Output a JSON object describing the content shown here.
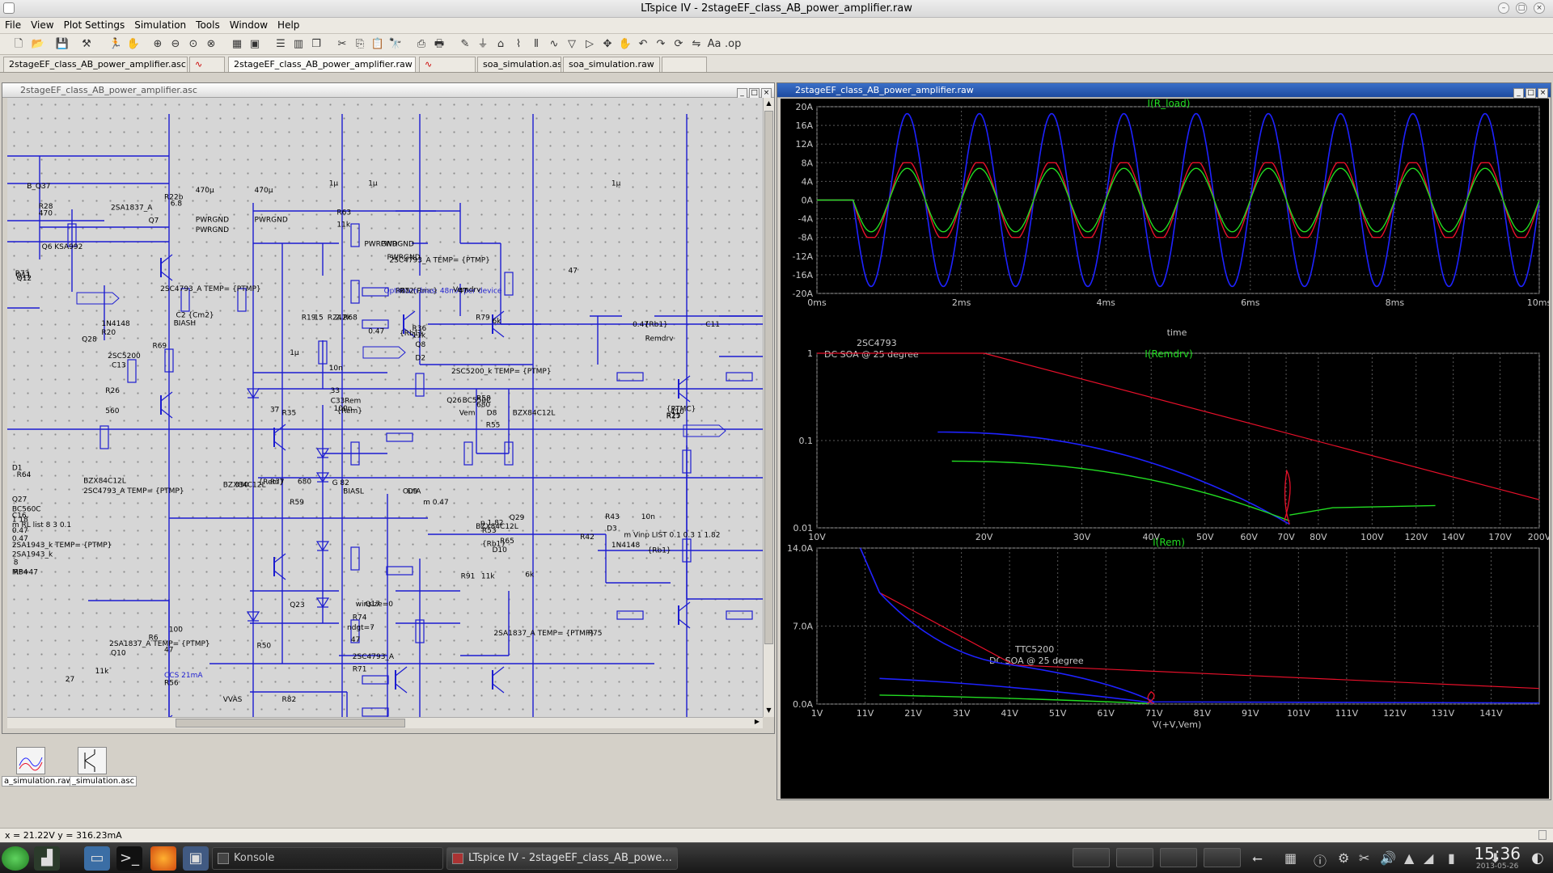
{
  "window": {
    "title": "LTspice IV - 2stageEF_class_AB_power_amplifier.raw"
  },
  "menu": [
    "File",
    "View",
    "Plot Settings",
    "Simulation",
    "Tools",
    "Window",
    "Help"
  ],
  "tabs": [
    {
      "label": "2stageEF_class_AB_power_amplifier.asc",
      "active": false
    },
    {
      "label": "",
      "active": false
    },
    {
      "label": "2stageEF_class_AB_power_amplifier.raw",
      "active": true
    },
    {
      "label": "",
      "active": false
    },
    {
      "label": "soa_simulation.asc",
      "active": false
    },
    {
      "label": "soa_simulation.raw",
      "active": false
    },
    {
      "label": "",
      "active": false
    }
  ],
  "schematic": {
    "title": "2stageEF_class_AB_power_amplifier.asc",
    "labels": [
      {
        "t": "B_Q37"
      },
      {
        "t": "R28"
      },
      {
        "t": "470"
      },
      {
        "t": "2SA1837_A"
      },
      {
        "t": "R22b"
      },
      {
        "t": "6.8"
      },
      {
        "t": "Q7"
      },
      {
        "t": "470µ"
      },
      {
        "t": "470µ"
      },
      {
        "t": "1µ"
      },
      {
        "t": "R63"
      },
      {
        "t": "11k"
      },
      {
        "t": "1µ"
      },
      {
        "t": "1µ"
      },
      {
        "t": "Q6"
      },
      {
        "t": "KSA992"
      },
      {
        "t": "PWRGND"
      },
      {
        "t": "PWRGND"
      },
      {
        "t": "PWRGND"
      },
      {
        "t": "PWRGND"
      },
      {
        "t": "PWRGND"
      },
      {
        "t": "PWRGND"
      },
      {
        "t": "2SC4793_A TEMP= {PTMP}"
      },
      {
        "t": "R73"
      },
      {
        "t": "47"
      },
      {
        "t": "R85 {Rmc}"
      },
      {
        "t": "Optimum bias: 48mA per device"
      },
      {
        "t": "R72"
      },
      {
        "t": "47"
      },
      {
        "t": "Q11"
      },
      {
        "t": "Q12"
      },
      {
        "t": "2SC4793_A TEMP= {PTMP}"
      },
      {
        "t": "C2 {Cm2}"
      },
      {
        "t": "BIASH"
      },
      {
        "t": "R19"
      },
      {
        "t": "15"
      },
      {
        "t": "R24"
      },
      {
        "t": "2.2k"
      },
      {
        "t": "R79"
      },
      {
        "t": "6k"
      },
      {
        "t": "R36"
      },
      {
        "t": "11k"
      },
      {
        "t": "Vemdrv"
      },
      {
        "t": "1N4148"
      },
      {
        "t": "R20"
      },
      {
        "t": "0.47"
      },
      {
        "t": "R68"
      },
      {
        "t": "{Rb1}"
      },
      {
        "t": "Q28"
      },
      {
        "t": "R69"
      },
      {
        "t": "{Rb1}"
      },
      {
        "t": "Remdrv"
      },
      {
        "t": "0.47"
      },
      {
        "t": "C11"
      },
      {
        "t": "1µ"
      },
      {
        "t": "Q8"
      },
      {
        "t": "D2"
      },
      {
        "t": "2SC5200_k TEMP= {PTMP}"
      },
      {
        "t": "2SC5200"
      },
      {
        "t": "C13"
      },
      {
        "t": "10n"
      },
      {
        "t": "R26"
      },
      {
        "t": "560"
      },
      {
        "t": "Q26"
      },
      {
        "t": "BC550C"
      },
      {
        "t": "R58"
      },
      {
        "t": "680"
      },
      {
        "t": "Vem"
      },
      {
        "t": "D8"
      },
      {
        "t": "BZX84C12L"
      },
      {
        "t": "R55"
      },
      {
        "t": "{RTMC}"
      },
      {
        "t": "R25"
      },
      {
        "t": "37"
      },
      {
        "t": "R35"
      },
      {
        "t": "410"
      },
      {
        "t": "R17"
      },
      {
        "t": "33"
      },
      {
        "t": "C33"
      },
      {
        "t": "100n"
      },
      {
        "t": "Rem"
      },
      {
        "t": "{Rem}"
      },
      {
        "t": "D1"
      },
      {
        "t": "BZX84C12L"
      },
      {
        "t": "2SC4793_A TEMP= {PTMP}"
      },
      {
        "t": "OutA"
      },
      {
        "t": "BIASL"
      },
      {
        "t": "D9"
      },
      {
        "t": "R64"
      },
      {
        "t": "330"
      },
      {
        "t": "BZX84C12L"
      },
      {
        "t": "R77"
      },
      {
        "t": "{Rem}"
      },
      {
        "t": "m 0.47"
      },
      {
        "t": "Q27"
      },
      {
        "t": "R59"
      },
      {
        "t": "680"
      },
      {
        "t": "G 82"
      },
      {
        "t": "BC560C"
      },
      {
        "t": "C16"
      },
      {
        "t": "10n"
      },
      {
        "t": "1 18"
      },
      {
        "t": "Q29"
      },
      {
        "t": "p 1.82"
      },
      {
        "t": "BZX84C12L"
      },
      {
        "t": "D10"
      },
      {
        "t": "R53"
      },
      {
        "t": "{Rb1}"
      },
      {
        "t": "R65"
      },
      {
        "t": "{Rb1}"
      },
      {
        "t": "m Vinp LIST 0.1 0.3 1 1.82"
      },
      {
        "t": "R43"
      },
      {
        "t": "R42"
      },
      {
        "t": "m RL list 8 3 0.1"
      },
      {
        "t": "D3"
      },
      {
        "t": "1N4148"
      },
      {
        "t": "0.47"
      },
      {
        "t": "0.47"
      },
      {
        "t": "2SA1943_k TEMP= {PTMP}"
      },
      {
        "t": "2SA1943_k"
      },
      {
        "t": "8"
      },
      {
        "t": "R84"
      },
      {
        "t": "6k"
      },
      {
        "t": "R91"
      },
      {
        "t": "11k"
      },
      {
        "t": "MP=47"
      },
      {
        "t": "winsize=0"
      },
      {
        "t": "R74"
      },
      {
        "t": "Q17"
      },
      {
        "t": "Q23"
      },
      {
        "t": "ndgt=7"
      },
      {
        "t": "47"
      },
      {
        "t": "2SA1837_A TEMP= {PTMP}"
      },
      {
        "t": "R75"
      },
      {
        "t": "47"
      },
      {
        "t": "2SA1837_A TEMP= {PTMP}"
      },
      {
        "t": "Q10"
      },
      {
        "t": "R6"
      },
      {
        "t": "100"
      },
      {
        "t": "2SC4793_A"
      },
      {
        "t": "R71"
      },
      {
        "t": "11k"
      },
      {
        "t": "CCS 21mA"
      },
      {
        "t": "R56"
      },
      {
        "t": "27"
      },
      {
        "t": "VVAS"
      },
      {
        "t": "R82"
      },
      {
        "t": "R50"
      }
    ]
  },
  "plot": {
    "title": "2stageEF_class_AB_power_amplifier.raw",
    "pane1": {
      "trace": "I(R_load)",
      "xlabel": "time",
      "yticks": [
        "20A",
        "16A",
        "12A",
        "8A",
        "4A",
        "0A",
        "-4A",
        "-8A",
        "-12A",
        "-16A",
        "-20A"
      ],
      "xticks": [
        "0ms",
        "2ms",
        "4ms",
        "6ms",
        "8ms",
        "10ms"
      ]
    },
    "pane2": {
      "trace": "I(Remdrv)",
      "annotation1": "2SC4793",
      "annotation2": "DC SOA @ 25 degree",
      "yticks": [
        "1",
        "0.1",
        "0.01"
      ],
      "xticks": [
        "10V",
        "20V",
        "30V",
        "40V",
        "50V",
        "60V",
        "70V",
        "80V",
        "100V",
        "120V",
        "140V",
        "170V",
        "200V"
      ]
    },
    "pane3": {
      "trace": "I(Rem)",
      "annotation1": "TTC5200",
      "annotation2": "DC SOA @ 25 degree",
      "xlabel": "V(+V,Vem)",
      "yticks": [
        "14.0A",
        "7.0A",
        "0.0A"
      ],
      "xticks": [
        "1V",
        "11V",
        "21V",
        "31V",
        "41V",
        "51V",
        "61V",
        "71V",
        "81V",
        "91V",
        "101V",
        "111V",
        "121V",
        "131V",
        "141V"
      ]
    }
  },
  "icons": {
    "label1": "a_simulation.raw",
    "label2": "_simulation.asc"
  },
  "statusbar": {
    "coords": "x = 21.22V   y = 316.23mA"
  },
  "taskbar": {
    "items": [
      "Konsole",
      "LTspice IV - 2stageEF_class_AB_powe..."
    ],
    "time": "15:36",
    "date": "2013-05-26"
  },
  "colors": {
    "plot_bg": "#000000",
    "grid": "#5a5a5a",
    "trace_blue": "#1e22ff",
    "trace_red": "#e8102a",
    "trace_green": "#22dd22",
    "title_green": "#22dd22",
    "wire": "#1c1cd0"
  }
}
